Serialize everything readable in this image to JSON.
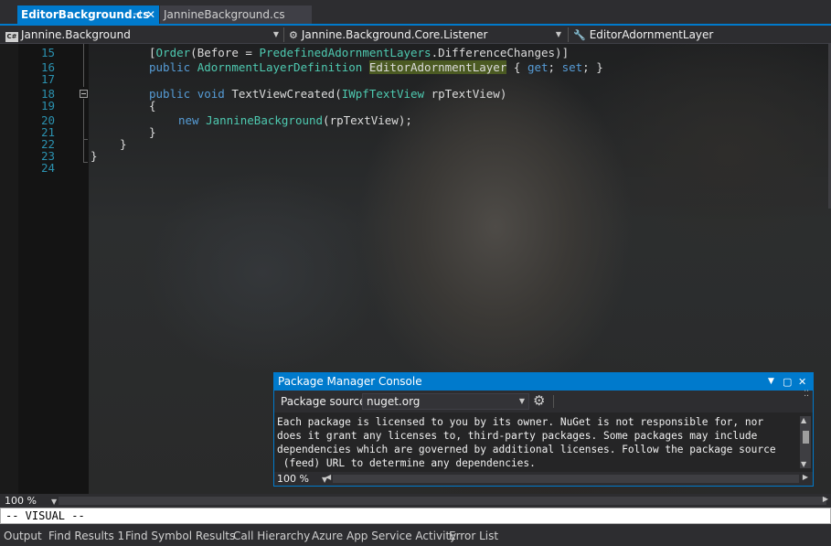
{
  "tabs": [
    {
      "label": "EditorBackground.cs",
      "active": true
    },
    {
      "label": "JannineBackground.cs",
      "active": false
    }
  ],
  "navbar": {
    "project": "Jannine.Background",
    "type": "Jannine.Background.Core.Listener",
    "member": "EditorAdornmentLayer",
    "project_icon": "cs-project-icon",
    "type_icon": "class-icon",
    "member_icon": "wrench-icon"
  },
  "editor": {
    "line_numbers": [
      "15",
      "16",
      "17",
      "18",
      "19",
      "20",
      "21",
      "22",
      "23",
      "24"
    ],
    "code": {
      "l15_a": "[",
      "l15_order": "Order",
      "l15_b": "(Before = ",
      "l15_type": "PredefinedAdornmentLayers",
      "l15_c": ".DifferenceChanges)]",
      "l16_public": "public",
      "l16_type": "AdornmentLayerDefinition",
      "l16_name": "EditorAdornmentLayer",
      "l16_a": " { ",
      "l16_get": "get",
      "l16_b": "; ",
      "l16_set": "set",
      "l16_c": "; }",
      "l18_public": "public",
      "l18_void": "void",
      "l18_a": " TextViewCreated(",
      "l18_type": "IWpfTextView",
      "l18_b": " rpTextView)",
      "l19": "{",
      "l20_new": "new",
      "l20_type": "JannineBackground",
      "l20_a": "(rpTextView);",
      "l21": "}",
      "l22": "}",
      "l23": "}"
    },
    "zoom": "100 %"
  },
  "pmc": {
    "title": "Package Manager Console",
    "source_label": "Package source:",
    "source_value": "nuget.org",
    "text_lines": [
      "Each package is licensed to you by its owner. NuGet is not responsible for, nor",
      "does it grant any licenses to, third-party packages. Some packages may include",
      "dependencies which are governed by additional licenses. Follow the package source",
      " (feed) URL to determine any dependencies."
    ],
    "zoom": "100 %"
  },
  "command_line": "-- VISUAL --",
  "bottom_tabs": [
    "Output",
    "Find Results 1",
    "Find Symbol Results",
    "Call Hierarchy",
    "Azure App Service Activity",
    "Error List"
  ],
  "colors": {
    "accent": "#007acc",
    "keyword": "#569cd6",
    "type": "#4ec9b0",
    "line_number": "#2b91af",
    "highlight": "#4b5a22"
  }
}
